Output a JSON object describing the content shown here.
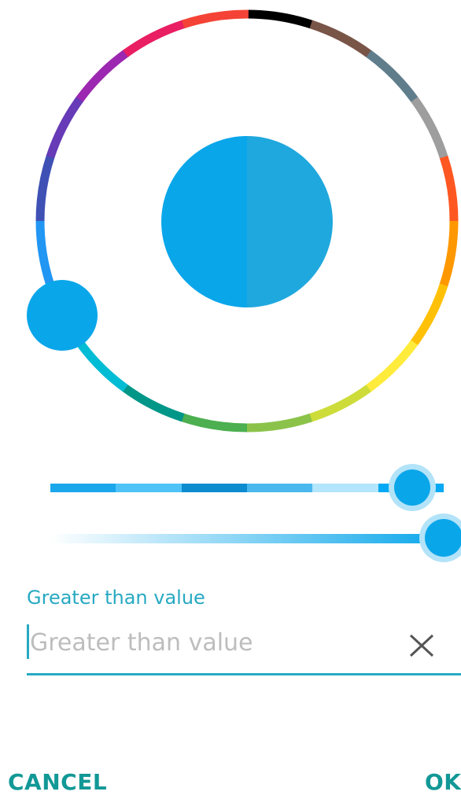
{
  "colors": {
    "accent": "#27a9c2",
    "selected_old": "#0aa6ea",
    "selected_new": "#1fa8de",
    "thumb": "#0aa6ea",
    "thumb_halo": "#b3e3f8",
    "button": "#129896",
    "icon": "#555555"
  },
  "wheel": {
    "segments": [
      "#000000",
      "#795548",
      "#607d8b",
      "#9e9e9e",
      "#ff5722",
      "#ff9800",
      "#ffc107",
      "#ffeb3b",
      "#cddc39",
      "#8bc34a",
      "#4caf50",
      "#009688",
      "#00bcd4",
      "#03a9f4",
      "#2196f3",
      "#3f51b5",
      "#673ab7",
      "#9c27b0",
      "#e91e63",
      "#f44336"
    ]
  },
  "shades": [
    "#1ca7ec",
    "#4fc3f7",
    "#0d8bcf",
    "#4ab8ef",
    "#b3e5fc",
    "#03a9f4"
  ],
  "shade_selected_fraction": 0.92,
  "alpha_level": 1.0,
  "input": {
    "label": "Greater than value",
    "placeholder": "Greater than value",
    "value": "",
    "clear_icon": "close-icon"
  },
  "buttons": {
    "cancel": "CANCEL",
    "ok": "OK"
  }
}
